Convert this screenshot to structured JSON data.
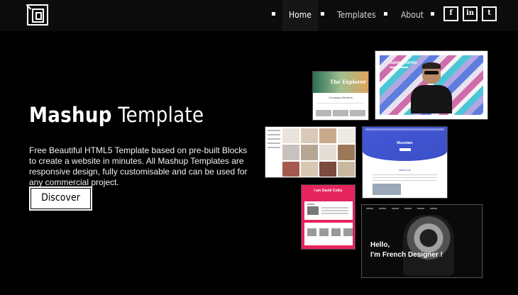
{
  "nav": {
    "items": [
      {
        "label": "Home",
        "active": true
      },
      {
        "label": "Templates",
        "active": false
      },
      {
        "label": "About",
        "active": false
      }
    ],
    "social": [
      {
        "label": "f",
        "icon": "facebook-icon"
      },
      {
        "label": "in",
        "icon": "linkedin-icon"
      },
      {
        "label": "t",
        "icon": "twitter-icon"
      }
    ]
  },
  "hero": {
    "title_bold": "Mashup",
    "title_light": "Template",
    "description": "Free Beautiful HTML5 Template based on pre-built Blocks to create a website in minutes. All Mashup Templates are responsive design, fully customisable and can be used for any commercial project.",
    "cta_label": "Discover"
  },
  "previews": {
    "explorer": {
      "title": "The Explorer",
      "subtitle": "Company Services"
    },
    "james": {
      "title": "James Torres"
    },
    "mountain": {
      "title": "Mountain",
      "about": "About Us"
    },
    "david": {
      "title": "I am David Colby",
      "section": "About"
    },
    "french": {
      "line1": "Hello,",
      "line2": "I'm French Designer !"
    }
  },
  "colors": {
    "background": "#000000",
    "navbar": "#0c0c0c",
    "accent_pink": "#e5245e",
    "accent_blue": "#4458d9"
  }
}
